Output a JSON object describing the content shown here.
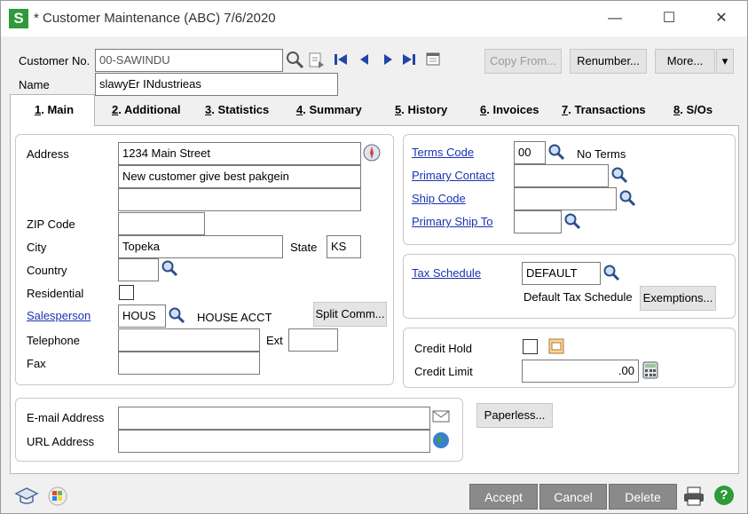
{
  "window": {
    "title": "* Customer Maintenance (ABC) 7/6/2020",
    "app_letter": "S",
    "minimize": "—",
    "maximize": "☐",
    "close": "✕"
  },
  "header": {
    "customer_no_label": "Customer No.",
    "customer_no_value": "00-SAWINDU",
    "name_label": "Name",
    "name_value": "slawyEr INdustrieas",
    "copy_from": "Copy From...",
    "renumber": "Renumber...",
    "more": "More...",
    "more_arrow": "▾"
  },
  "tabs": [
    {
      "num": "1",
      "label": ". Main"
    },
    {
      "num": "2",
      "label": ". Additional"
    },
    {
      "num": "3",
      "label": ". Statistics"
    },
    {
      "num": "4",
      "label": ". Summary"
    },
    {
      "num": "5",
      "label": ". History"
    },
    {
      "num": "6",
      "label": ". Invoices"
    },
    {
      "num": "7",
      "label": ". Transactions"
    },
    {
      "num": "8",
      "label": ". S/Os"
    }
  ],
  "address": {
    "address_label": "Address",
    "line1": "1234 Main Street",
    "line2": "New customer give best pakgein",
    "line3": "",
    "zip_label": "ZIP Code",
    "zip_value": "",
    "city_label": "City",
    "city_value": "Topeka",
    "state_label": "State",
    "state_value": "KS",
    "country_label": "Country",
    "country_value": "",
    "residential_label": "Residential",
    "salesperson_label": "Salesperson",
    "salesperson_value": "HOUS",
    "salesperson_desc": "HOUSE ACCT",
    "split_comm": "Split Comm...",
    "telephone_label": "Telephone",
    "telephone_value": "",
    "ext_label": "Ext",
    "ext_value": "",
    "fax_label": "Fax",
    "fax_value": ""
  },
  "terms": {
    "terms_code_label": "Terms Code",
    "terms_code_value": "00",
    "terms_desc": "No Terms",
    "primary_contact_label": "Primary Contact",
    "ship_code_label": "Ship Code",
    "primary_ship_to_label": "Primary Ship To"
  },
  "tax": {
    "tax_schedule_label": "Tax Schedule",
    "tax_schedule_value": "DEFAULT",
    "tax_desc": "Default Tax Schedule",
    "exemptions": "Exemptions..."
  },
  "credit": {
    "credit_hold_label": "Credit Hold",
    "credit_limit_label": "Credit Limit",
    "credit_limit_value": ".00"
  },
  "contact": {
    "email_label": "E-mail Address",
    "email_value": "",
    "url_label": "URL Address",
    "url_value": "",
    "paperless": "Paperless..."
  },
  "footer": {
    "accept": "Accept",
    "cancel": "Cancel",
    "delete": "Delete",
    "help": "?"
  }
}
